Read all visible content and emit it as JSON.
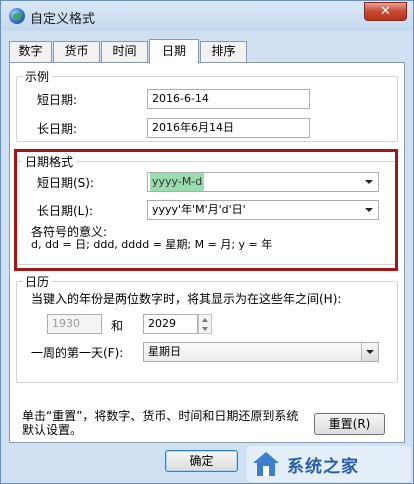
{
  "window": {
    "title": "自定义格式",
    "close_label": "✕"
  },
  "tabs": [
    {
      "label": "数字"
    },
    {
      "label": "货币"
    },
    {
      "label": "时间"
    },
    {
      "label": "日期"
    },
    {
      "label": "排序"
    }
  ],
  "example": {
    "group_label": "示例",
    "short_date_label": "短日期:",
    "short_date_value": "2016-6-14",
    "long_date_label": "长日期:",
    "long_date_value": "2016年6月14日"
  },
  "date_format": {
    "group_label": "日期格式",
    "short_date_label": "短日期(S):",
    "short_date_value": "yyyy-M-d",
    "long_date_label": "长日期(L):",
    "long_date_value": "yyyy'年'M'月'd'日'",
    "symbols_title": "各符号的意义:",
    "symbols_text": "d, dd = 日;  ddd, dddd = 星期;  M = 月;  y = 年"
  },
  "calendar": {
    "group_label": "日历",
    "description": "当键入的年份是两位数字时，将其显示为在这些年之间(H):",
    "year_from": "1930",
    "and_label": "和",
    "year_to": "2029",
    "first_day_label": "一周的第一天(F):",
    "first_day_value": "星期日"
  },
  "footer": {
    "reset_note": "单击“重置”，将数字、货币、时间和日期还原到系统默认设置。",
    "reset_label": "重置(R)",
    "ok_label": "确定"
  },
  "watermark": {
    "text": "系统之家"
  },
  "colors": {
    "highlight_border": "#a31616",
    "selection": "#9bdcae"
  }
}
